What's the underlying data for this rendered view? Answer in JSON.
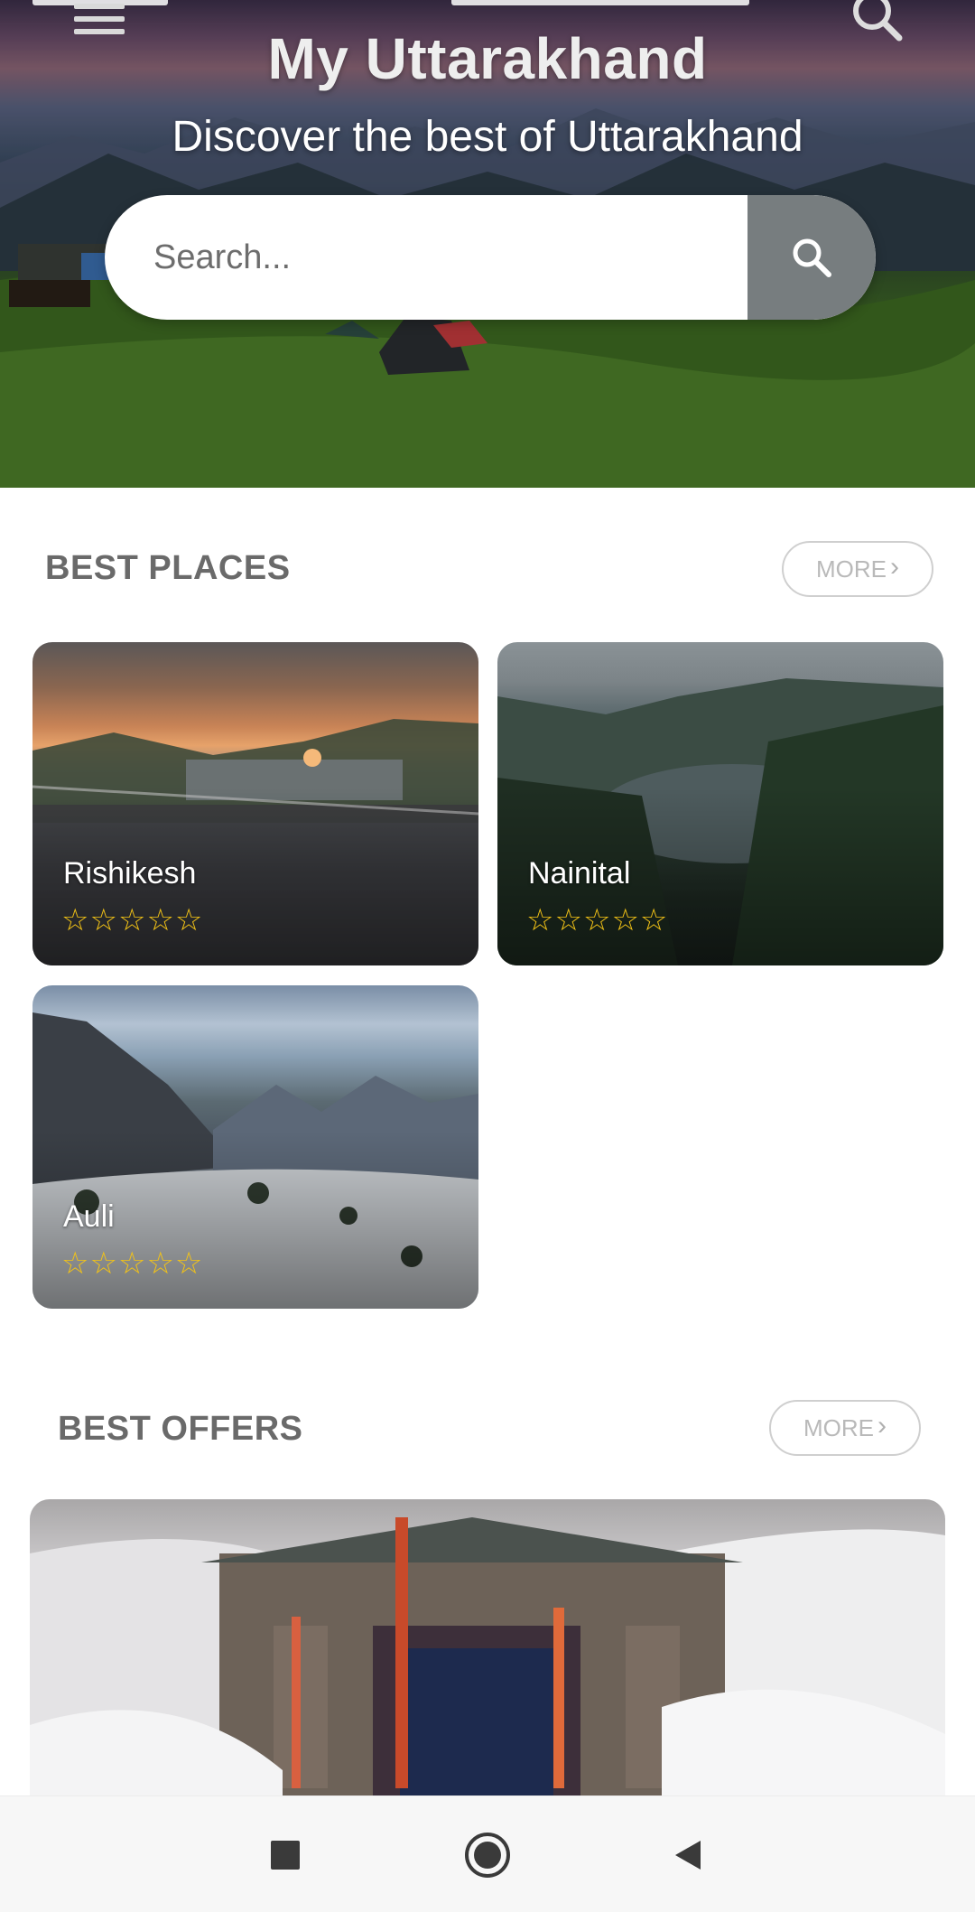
{
  "header": {
    "title": "My Uttarakhand",
    "subtitle": "Discover the best of Uttarakhand"
  },
  "icons": {
    "menu": "menu-icon",
    "top_search": "search-icon",
    "search_button": "search-icon"
  },
  "search": {
    "placeholder": "Search...",
    "value": ""
  },
  "best_places": {
    "title": "BEST PLACES",
    "more_label": "MORE",
    "more_icon": "chevron-right-icon",
    "items": [
      {
        "name": "Rishikesh",
        "stars": "☆☆☆☆☆",
        "rating": 0
      },
      {
        "name": "Nainital",
        "stars": "☆☆☆☆☆",
        "rating": 0
      },
      {
        "name": "Auli",
        "stars": "☆☆☆☆☆",
        "rating": 0
      }
    ]
  },
  "best_offers": {
    "title": "BEST OFFERS",
    "more_label": "MORE",
    "more_icon": "chevron-right-icon"
  },
  "nav": {
    "recents_icon": "square-icon",
    "home_icon": "circle-icon",
    "back_icon": "triangle-back-icon"
  },
  "colors": {
    "star": "#f3c316",
    "search_button": "#777d7f",
    "section_title": "#6a6a6a",
    "more_border": "#cfcfcf"
  }
}
